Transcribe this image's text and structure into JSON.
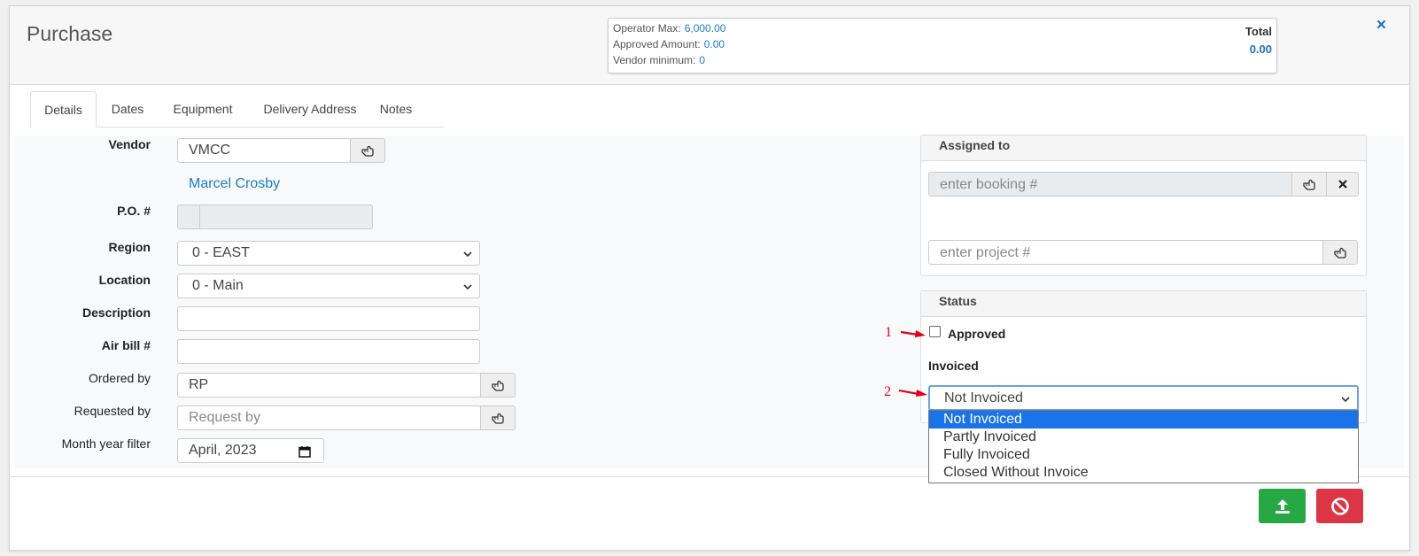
{
  "modal": {
    "title": "Purchase",
    "close_icon": "×"
  },
  "summary": {
    "operator_max_label": "Operator Max:",
    "operator_max_value": "6,000.00",
    "approved_amount_label": "Approved Amount:",
    "approved_amount_value": "0.00",
    "vendor_minimum_label": "Vendor minimum:",
    "vendor_minimum_value": "0",
    "total_label": "Total",
    "total_value": "0.00"
  },
  "tabs": [
    {
      "label": "Details",
      "active": true
    },
    {
      "label": "Dates"
    },
    {
      "label": "Equipment"
    },
    {
      "label": "Delivery Address"
    },
    {
      "label": "Notes"
    }
  ],
  "form": {
    "vendor_label": "Vendor",
    "vendor_value": "VMCC",
    "vendor_contact": "Marcel Crosby",
    "po_label": "P.O. #",
    "region_label": "Region",
    "region_value": "0 - EAST",
    "location_label": "Location",
    "location_value": "0 - Main",
    "description_label": "Description",
    "airbill_label": "Air bill #",
    "ordered_by_label": "Ordered by",
    "ordered_by_value": "RP",
    "requested_by_label": "Requested by",
    "requested_by_placeholder": "Request by",
    "month_year_label": "Month year filter",
    "month_year_value": "April, 2023"
  },
  "assigned": {
    "heading": "Assigned to",
    "booking_placeholder": "enter booking #",
    "project_placeholder": "enter project #"
  },
  "status": {
    "heading": "Status",
    "approved_label": "Approved",
    "invoiced_label": "Invoiced",
    "invoiced_value": "Not Invoiced",
    "options": [
      "Not Invoiced",
      "Partly Invoiced",
      "Fully Invoiced",
      "Closed Without Invoice"
    ]
  },
  "annotations": [
    "1",
    "2"
  ],
  "colors": {
    "accent": "#1a6fc9",
    "save": "#28a745",
    "cancel": "#dc3545",
    "annotation": "#e0001a"
  }
}
